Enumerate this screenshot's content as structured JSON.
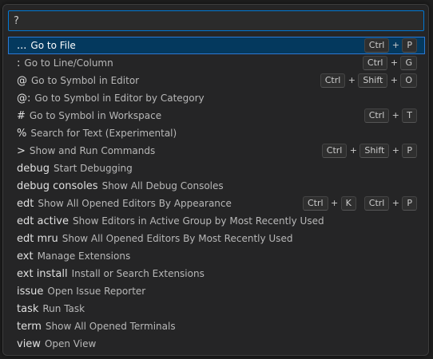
{
  "quick_open": {
    "input_value": "?",
    "items": [
      {
        "prefix": "...",
        "label": "Go to File",
        "keys": [
          [
            "Ctrl",
            "P"
          ]
        ]
      },
      {
        "prefix": ":",
        "label": "Go to Line/Column",
        "keys": [
          [
            "Ctrl",
            "G"
          ]
        ]
      },
      {
        "prefix": "@",
        "label": "Go to Symbol in Editor",
        "keys": [
          [
            "Ctrl",
            "Shift",
            "O"
          ]
        ]
      },
      {
        "prefix": "@:",
        "label": "Go to Symbol in Editor by Category",
        "keys": []
      },
      {
        "prefix": "#",
        "label": "Go to Symbol in Workspace",
        "keys": [
          [
            "Ctrl",
            "T"
          ]
        ]
      },
      {
        "prefix": "%",
        "label": "Search for Text (Experimental)",
        "keys": []
      },
      {
        "prefix": ">",
        "label": "Show and Run Commands",
        "keys": [
          [
            "Ctrl",
            "Shift",
            "P"
          ]
        ]
      },
      {
        "prefix": "debug",
        "label": "Start Debugging",
        "keys": []
      },
      {
        "prefix": "debug consoles",
        "label": "Show All Debug Consoles",
        "keys": []
      },
      {
        "prefix": "edt",
        "label": "Show All Opened Editors By Appearance",
        "keys": [
          [
            "Ctrl",
            "K"
          ],
          [
            "Ctrl",
            "P"
          ]
        ]
      },
      {
        "prefix": "edt active",
        "label": "Show Editors in Active Group by Most Recently Used",
        "keys": []
      },
      {
        "prefix": "edt mru",
        "label": "Show All Opened Editors By Most Recently Used",
        "keys": []
      },
      {
        "prefix": "ext",
        "label": "Manage Extensions",
        "keys": []
      },
      {
        "prefix": "ext install",
        "label": "Install or Search Extensions",
        "keys": []
      },
      {
        "prefix": "issue",
        "label": "Open Issue Reporter",
        "keys": []
      },
      {
        "prefix": "task",
        "label": "Run Task",
        "keys": []
      },
      {
        "prefix": "term",
        "label": "Show All Opened Terminals",
        "keys": []
      },
      {
        "prefix": "view",
        "label": "Open View",
        "keys": []
      }
    ],
    "selected_index": 0
  },
  "colors": {
    "accent": "#0078d4",
    "selection_bg": "#04395e"
  }
}
